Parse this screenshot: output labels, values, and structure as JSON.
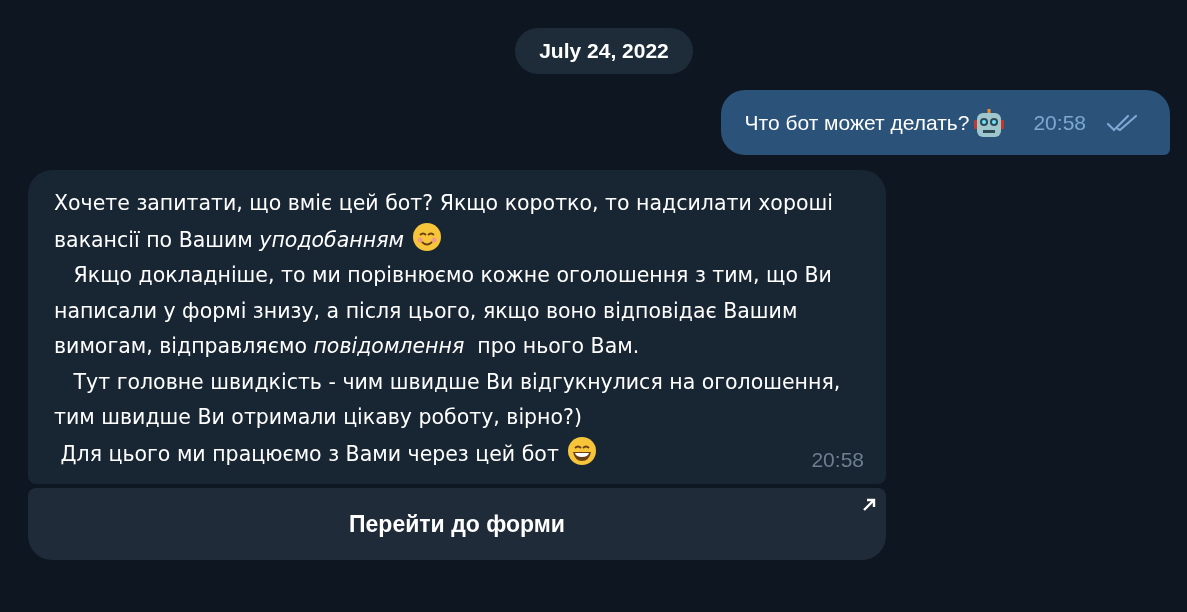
{
  "date": "July 24, 2022",
  "outgoing": {
    "text": "Что бот может делать?",
    "emoji": {
      "kind": "robot"
    },
    "time": "20:58",
    "read": true
  },
  "incoming": {
    "paragraphs": [
      {
        "text": "Хочете запитати, що вміє цей бот? Якщо коротко, то надсилати хороші вакансії по Вашим *уподобанням*",
        "emoji": {
          "kind": "smiling"
        }
      },
      {
        "text": "   Якщо докладніше, то ми порівнюємо кожне оголошення з тим, що Ви написали у формі знизу, а після цього, якщо воно відповідає Вашим вимогам, відправляємо *повідомлення*  про нього Вам."
      },
      {
        "text": "   Тут головне швидкість - чим швидше Ви відгукнулися на оголошення, тим швидше Ви отримали цікаву роботу, вірно?)"
      },
      {
        "text": " Для цього ми працюємо з Вами через цей бот",
        "emoji": {
          "kind": "grinning"
        }
      }
    ],
    "time": "20:58"
  },
  "button": {
    "label": "Перейти до форми"
  }
}
